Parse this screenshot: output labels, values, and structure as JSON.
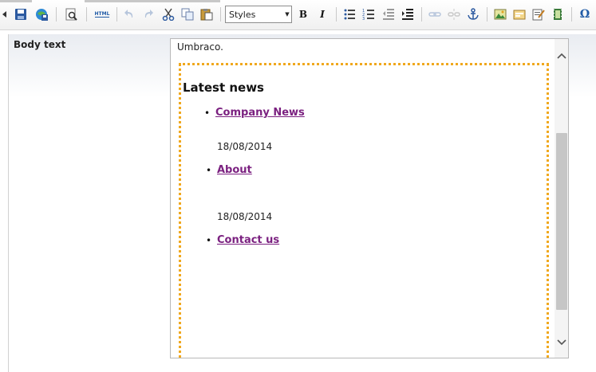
{
  "toolbar": {
    "styles_value": "Styles",
    "bold_label": "B",
    "italic_label": "I",
    "html_label": "HTML",
    "special_char_label": "Ω",
    "icons": [
      "collapse-arrow-icon",
      "save-icon",
      "save-publish-icon",
      "preview-icon",
      "html-source-icon",
      "undo-icon",
      "redo-icon",
      "cut-icon",
      "copy-icon",
      "paste-icon",
      "bold-icon",
      "italic-icon",
      "bullet-list-icon",
      "numbered-list-icon",
      "outdent-icon",
      "indent-icon",
      "link-icon",
      "unlink-icon",
      "anchor-icon",
      "image-icon",
      "macro-icon",
      "form-icon",
      "media-icon",
      "special-char-icon"
    ]
  },
  "property": {
    "label": "Body text"
  },
  "editor": {
    "intro_text": "Umbraco.",
    "heading": "Latest news",
    "items": [
      {
        "link": "Company News",
        "date": "18/08/2014"
      },
      {
        "link": "About",
        "date": "18/08/2014"
      },
      {
        "link": "Contact us"
      }
    ]
  },
  "colors": {
    "link": "#7b2180",
    "dotted_border": "#f0a81e",
    "toolbar_blue": "#1f5aa6"
  }
}
